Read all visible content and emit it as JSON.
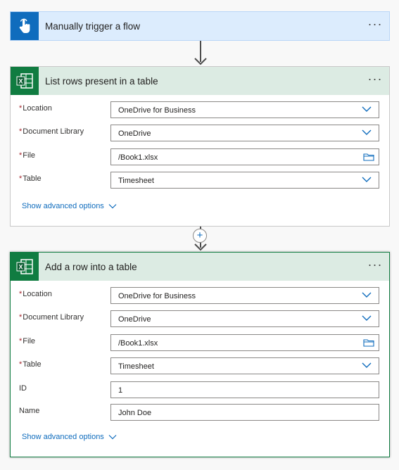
{
  "trigger": {
    "title": "Manually trigger a flow",
    "menu": "···"
  },
  "step1": {
    "title": "List rows present in a table",
    "menu": "···",
    "fields": [
      {
        "label": "Location",
        "required": true,
        "value": "OneDrive for Business"
      },
      {
        "label": "Document Library",
        "required": true,
        "value": "OneDrive"
      },
      {
        "label": "File",
        "required": true,
        "value": "/Book1.xlsx"
      },
      {
        "label": "Table",
        "required": true,
        "value": "Timesheet"
      }
    ],
    "advanced": "Show advanced options"
  },
  "step2": {
    "title": "Add a row into a table",
    "menu": "···",
    "fields": [
      {
        "label": "Location",
        "required": true,
        "value": "OneDrive for Business"
      },
      {
        "label": "Document Library",
        "required": true,
        "value": "OneDrive"
      },
      {
        "label": "File",
        "required": true,
        "value": "/Book1.xlsx"
      },
      {
        "label": "Table",
        "required": true,
        "value": "Timesheet"
      },
      {
        "label": "ID",
        "required": false,
        "value": "1"
      },
      {
        "label": "Name",
        "required": false,
        "value": "John Doe"
      }
    ],
    "advanced": "Show advanced options"
  },
  "insert": {
    "symbol": "+"
  },
  "colors": {
    "trigger_icon": "#0f6cbd",
    "excel": "#107c41",
    "link": "#0f6cbd",
    "required": "#a4262c"
  }
}
